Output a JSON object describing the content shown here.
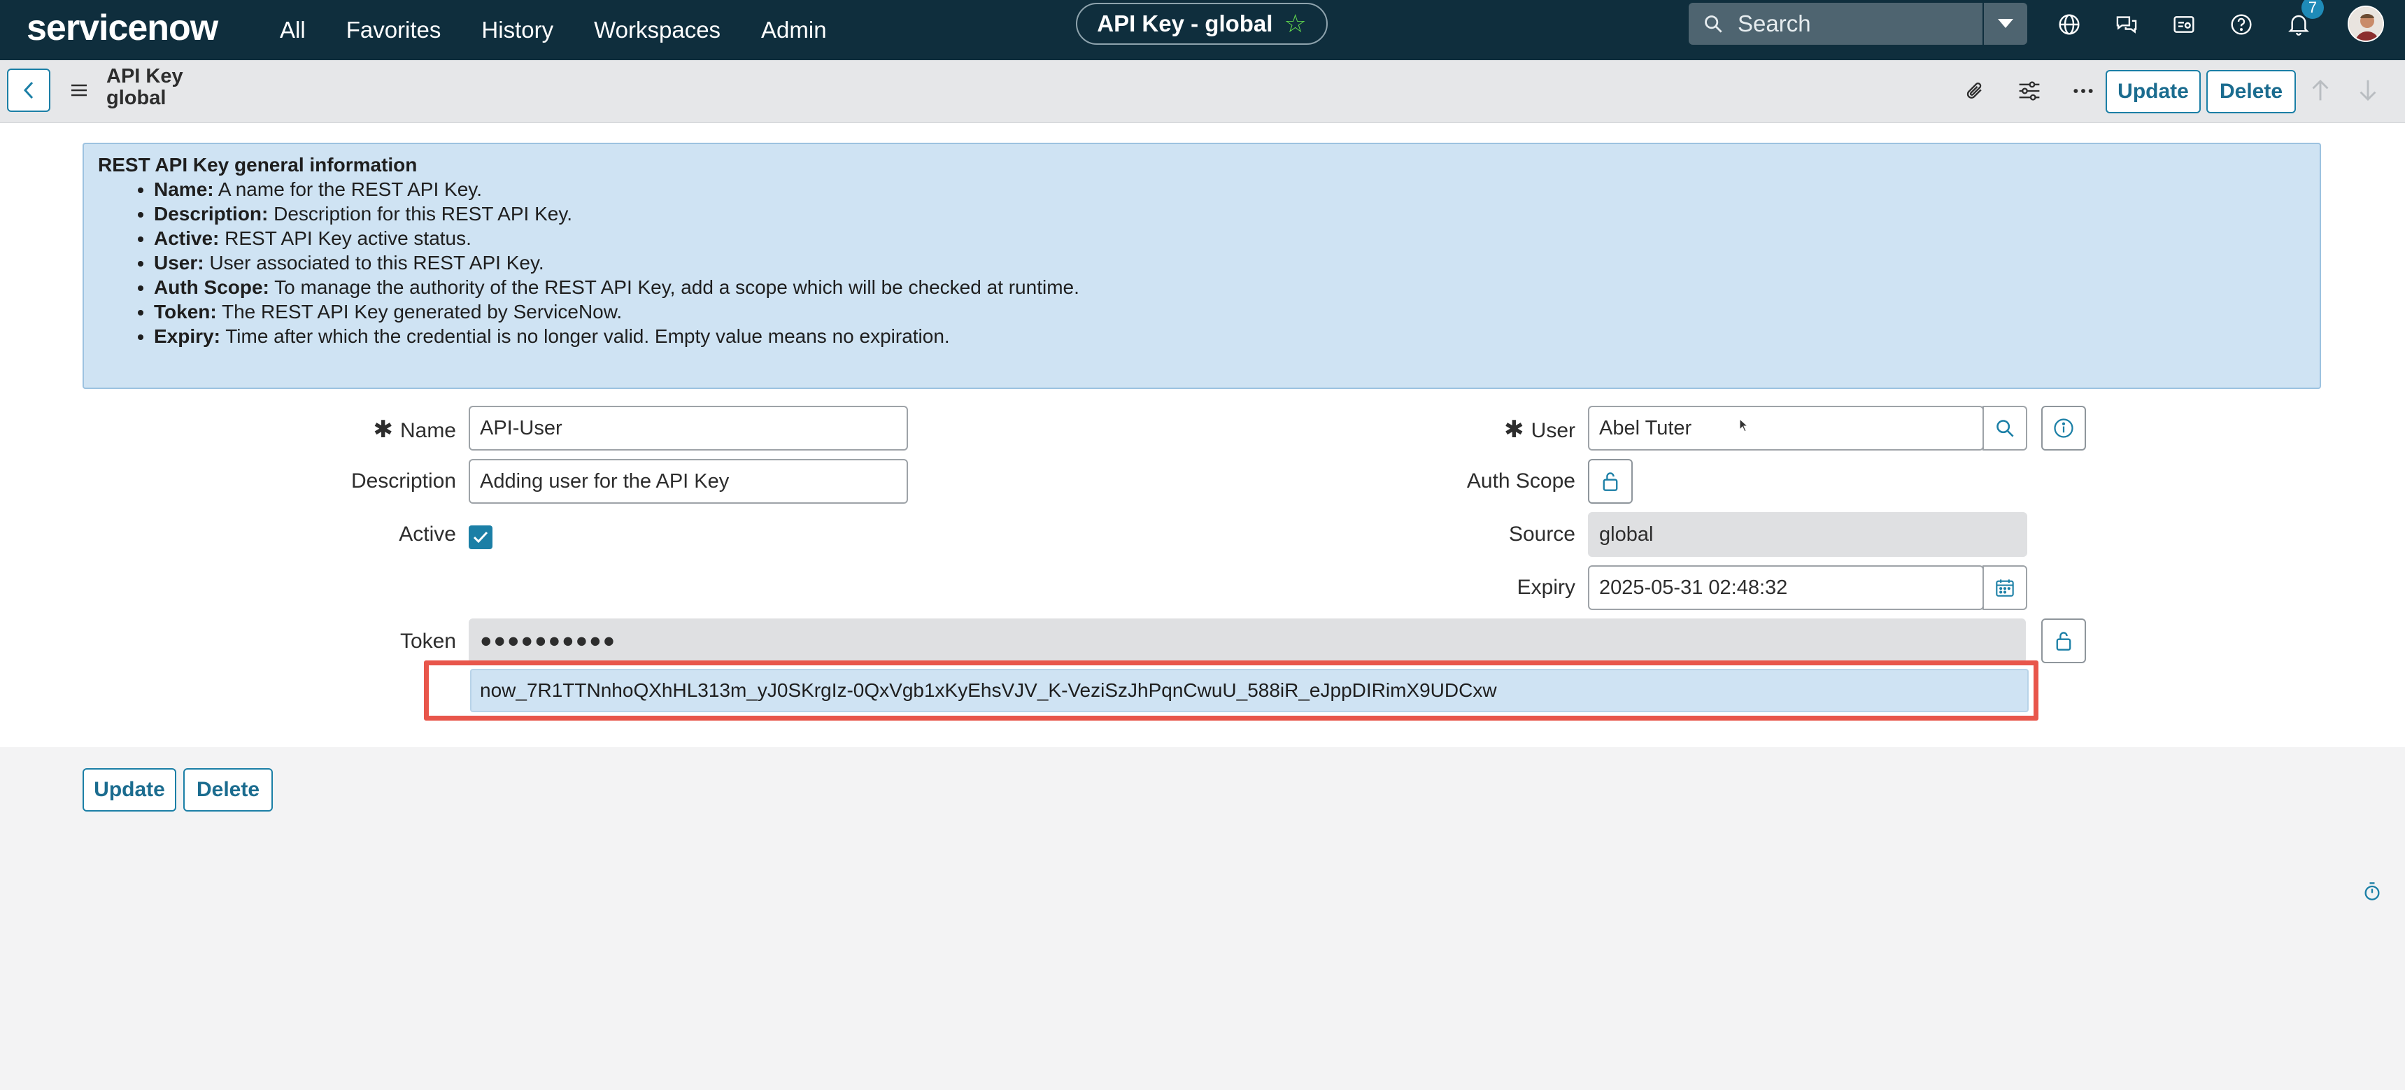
{
  "topnav": {
    "logo": "servicenow",
    "menu": [
      "All",
      "Favorites",
      "History",
      "Workspaces",
      "Admin"
    ],
    "context_title": "API Key - global",
    "search_placeholder": "Search",
    "notification_count": "7",
    "icons": [
      "search-icon",
      "globe-icon",
      "chat-icon",
      "scratchpad-icon",
      "help-icon",
      "bell-icon"
    ]
  },
  "record": {
    "table": "API Key",
    "scope": "global",
    "update_label": "Update",
    "delete_label": "Delete"
  },
  "info": {
    "heading": "REST API Key general information",
    "items": [
      {
        "term": "Name:",
        "desc": " A name for the REST API Key."
      },
      {
        "term": "Description:",
        "desc": " Description for this REST API Key."
      },
      {
        "term": "Active:",
        "desc": " REST API Key active status."
      },
      {
        "term": "User:",
        "desc": " User associated to this REST API Key."
      },
      {
        "term": "Auth Scope:",
        "desc": " To manage the authority of the REST API Key, add a scope which will be checked at runtime."
      },
      {
        "term": "Token:",
        "desc": " The REST API Key generated by ServiceNow."
      },
      {
        "term": "Expiry:",
        "desc": " Time after which the credential is no longer valid. Empty value means no expiration."
      }
    ]
  },
  "form": {
    "name_label": "Name",
    "name_value": "API-User",
    "description_label": "Description",
    "description_value": "Adding user for the API Key",
    "active_label": "Active",
    "active_checked": true,
    "token_label": "Token",
    "token_masked": "●●●●●●●●●●",
    "token_value": "now_7R1TTNnhoQXhHL313m_yJ0SKrgIz-0QxVgb1xKyEhsVJV_K-VeziSzJhPqnCwuU_588iR_eJppDIRimX9UDCxw",
    "user_label": "User",
    "user_value": "Abel Tuter",
    "auth_scope_label": "Auth Scope",
    "source_label": "Source",
    "source_value": "global",
    "expiry_label": "Expiry",
    "expiry_value": "2025-05-31 02:48:32"
  },
  "footer": {
    "update_label": "Update",
    "delete_label": "Delete"
  }
}
